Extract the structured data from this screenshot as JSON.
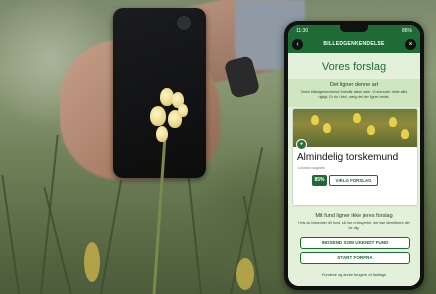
{
  "photo": {
    "description_icons": [
      "hand-icon",
      "phone-back-icon",
      "flower-icon"
    ]
  },
  "app": {
    "status_bar": {
      "time": "11:30",
      "battery": "86%"
    },
    "header": {
      "title": "BILLEDGENKENDELSE",
      "back_icon": "chevron-left-icon",
      "close_icon": "close-icon"
    },
    "main_title": "Vores forslag",
    "intro": {
      "subtitle": "Det ligner denne art",
      "description": "Vores billedgenkendelse foreslår disse arter. Vi anmoder dette altid rigtigt. Er du i tvivl, vælg det der ligner bedst."
    },
    "suggestion": {
      "species_name": "Almindelig torskemund",
      "latin_name": "Linaria vulgaris",
      "confidence": "85%",
      "choose_label": "VÆLG FORSLAG"
    },
    "no_match": {
      "question": "Mit fund ligner ikke jeres forslag",
      "description": "Hvis du indsender dit fund, så har vi eksperter, der kan identificere det for dig.",
      "submit_unknown_label": "INDSEND SOM UKENDT FUND",
      "restart_label": "START FORFRA"
    },
    "footer": "Fundene og andre brugere vil fastlage"
  },
  "colors": {
    "accent": "#1f6b35",
    "pane": "#e4f1da",
    "band": "#cfe6c1"
  }
}
